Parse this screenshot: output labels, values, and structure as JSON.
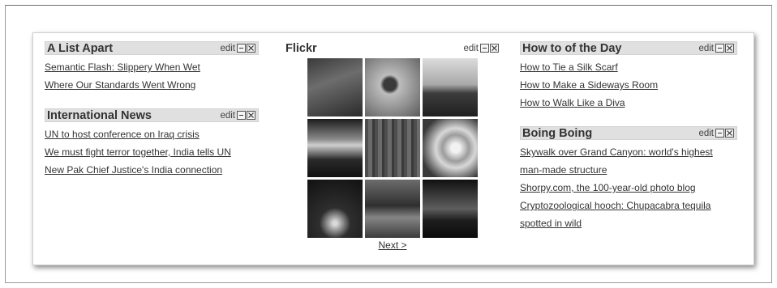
{
  "widgets_left": [
    {
      "title": "A List Apart",
      "edit_label": "edit",
      "items": [
        "Semantic Flash: Slippery When Wet",
        "Where Our Standards Went Wrong"
      ]
    },
    {
      "title": "International News",
      "edit_label": "edit",
      "items": [
        "UN to host conference on Iraq crisis",
        "We must fight terror together, India tells UN",
        "New Pak Chief Justice's India connection"
      ]
    }
  ],
  "flickr": {
    "title": "Flickr",
    "edit_label": "edit",
    "next_label": "Next >"
  },
  "widgets_right": [
    {
      "title": "How to of the Day",
      "edit_label": "edit",
      "items": [
        "How to Tie a Silk Scarf",
        "How to Make a Sideways Room",
        "How to Walk Like a Diva"
      ]
    },
    {
      "title": "Boing Boing",
      "edit_label": "edit",
      "items": [
        "Skywalk over Grand Canyon: world's highest man-made structure",
        "Shorpy.com, the 100-year-old photo blog",
        "Cryptozoological hooch: Chupacabra tequila spotted in wild"
      ]
    }
  ],
  "icons": {
    "minimize": "minimize-icon",
    "close": "close-icon"
  }
}
